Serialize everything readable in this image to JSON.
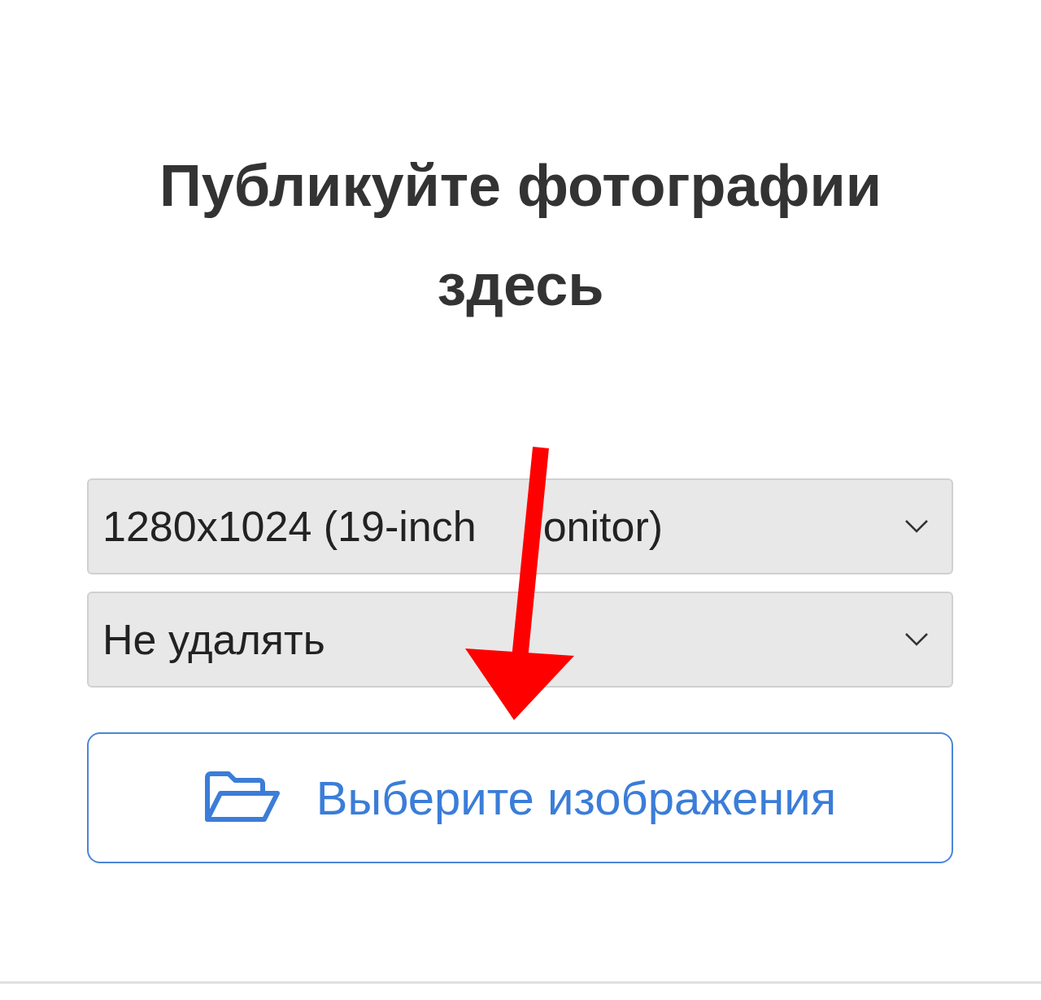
{
  "title": "Публикуйте фотографии здесь",
  "selects": [
    {
      "value": "1280x1024 (19-inch",
      "value_after_arrow": "onitor)"
    },
    {
      "value": "Не удалять"
    }
  ],
  "button": {
    "label": "Выберите изображения"
  },
  "annotation": {
    "kind": "arrow"
  }
}
